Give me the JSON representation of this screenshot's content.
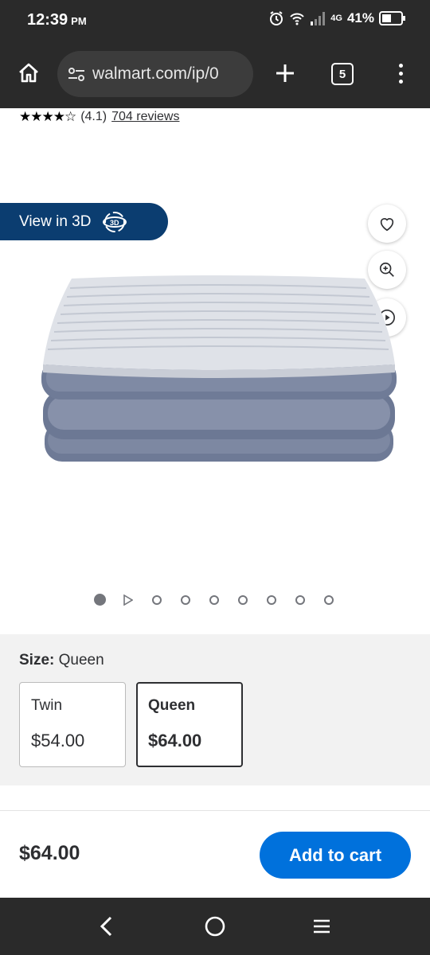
{
  "status": {
    "time": "12:39",
    "ampm": "PM",
    "network": "4G",
    "battery": "41%"
  },
  "browser": {
    "url": "walmart.com/ip/0",
    "tab_count": "5",
    "icons": [
      "home-icon",
      "site-settings-icon",
      "plus-icon",
      "tabs-icon",
      "more-vert-icon"
    ]
  },
  "product": {
    "rating_value": 4.1,
    "rating_text": "(4.1)",
    "reviews_link": "704 reviews",
    "view3d_label": "View in 3D",
    "image_count": 9,
    "active_image": 1
  },
  "size": {
    "label": "Size:",
    "selected_value": "Queen",
    "options": [
      {
        "name": "Twin",
        "price": "$54.00",
        "selected": false
      },
      {
        "name": "Queen",
        "price": "$64.00",
        "selected": true
      }
    ]
  },
  "footer": {
    "price": "$64.00",
    "add_to_cart": "Add to cart"
  },
  "colors": {
    "walmart_blue": "#0071dc",
    "view3d_bg": "#0b3d70",
    "chrome_bg": "#2a2a2a"
  }
}
